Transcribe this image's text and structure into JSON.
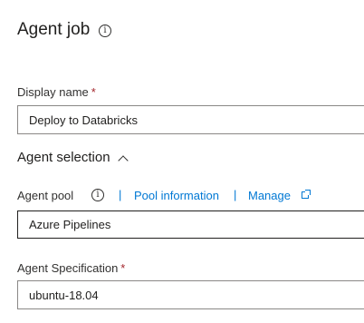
{
  "header": {
    "title": "Agent job",
    "info_icon": "info-icon"
  },
  "display_name": {
    "label": "Display name",
    "required_mark": "*",
    "value": "Deploy to Databricks"
  },
  "agent_selection": {
    "title": "Agent selection",
    "chevron_icon": "chevron-up-icon",
    "expanded": true
  },
  "agent_pool": {
    "label": "Agent pool",
    "info_icon": "info-icon",
    "separator": "|",
    "pool_information_link": "Pool information",
    "manage_link": "Manage",
    "external_link_icon": "external-link-icon",
    "value": "Azure Pipelines"
  },
  "agent_specification": {
    "label": "Agent Specification",
    "required_mark": "*",
    "value": "ubuntu-18.04"
  },
  "colors": {
    "link": "#0078d4",
    "required": "#a4262c",
    "text": "#323130"
  }
}
